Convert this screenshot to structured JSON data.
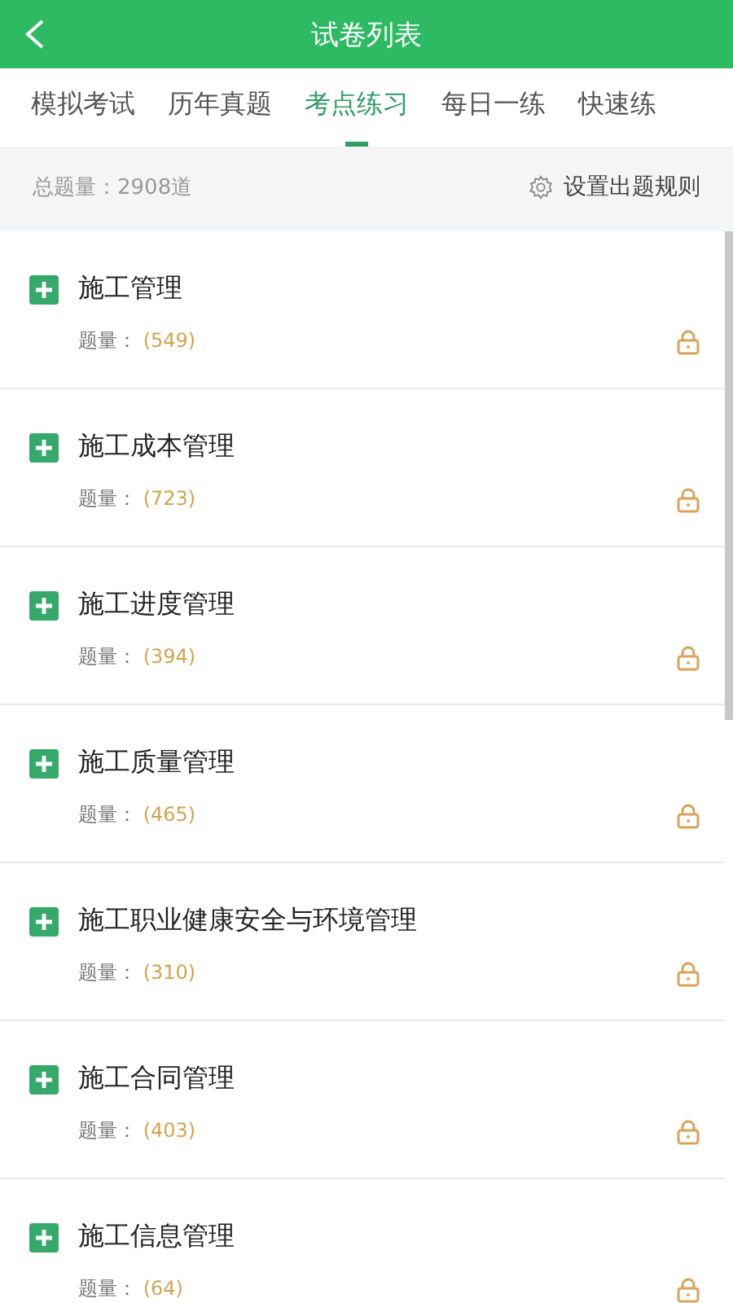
{
  "header": {
    "title": "试卷列表"
  },
  "tabs": [
    {
      "label": "模拟考试",
      "selected": false
    },
    {
      "label": "历年真题",
      "selected": false
    },
    {
      "label": "考点练习",
      "selected": true
    },
    {
      "label": "每日一练",
      "selected": false
    },
    {
      "label": "快速练",
      "selected": false
    }
  ],
  "summary": {
    "total": "总题量：2908道",
    "settings": "设置出题规则"
  },
  "chapters": [
    {
      "title": "施工管理",
      "count_label": "题量：",
      "count": "(549)",
      "locked": true
    },
    {
      "title": "施工成本管理",
      "count_label": "题量：",
      "count": "(723)",
      "locked": true
    },
    {
      "title": "施工进度管理",
      "count_label": "题量：",
      "count": "(394)",
      "locked": true
    },
    {
      "title": "施工质量管理",
      "count_label": "题量：",
      "count": "(465)",
      "locked": true
    },
    {
      "title": "施工职业健康安全与环境管理",
      "count_label": "题量：",
      "count": "(310)",
      "locked": true
    },
    {
      "title": "施工合同管理",
      "count_label": "题量：",
      "count": "(403)",
      "locked": true
    },
    {
      "title": "施工信息管理",
      "count_label": "题量：",
      "count": "(64)",
      "locked": true
    }
  ]
}
